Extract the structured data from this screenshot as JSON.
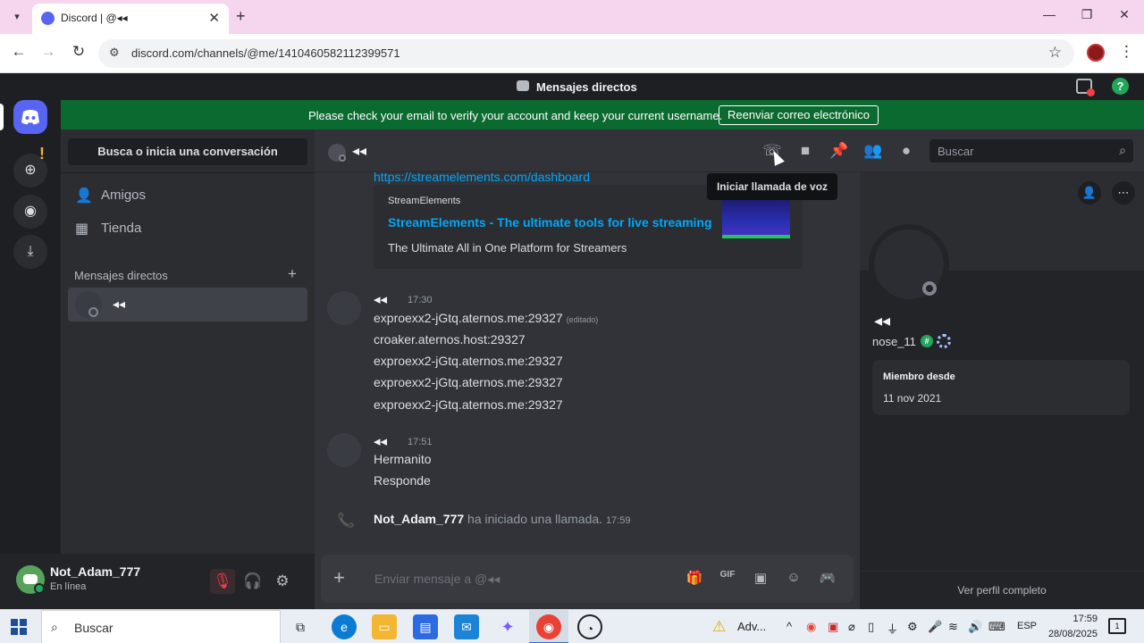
{
  "browser": {
    "tab_title": "Discord | @◂◂",
    "url": "discord.com/channels/@me/1410460582112399571"
  },
  "app_header": {
    "title": "Mensajes directos"
  },
  "banner": {
    "text": "Please check your email to verify your account and keep your current username.",
    "button": "Reenviar correo electrónico"
  },
  "sidebar": {
    "search_label": "Busca o inicia una conversación",
    "items": [
      {
        "label": "Amigos",
        "icon": "friends-icon"
      },
      {
        "label": "Tienda",
        "icon": "shop-icon"
      }
    ],
    "dm_header": "Mensajes directos",
    "dms": [
      {
        "name": "◂◂"
      }
    ]
  },
  "user_panel": {
    "name": "Not_Adam_777",
    "status": "En línea"
  },
  "chat_header": {
    "name": "◂◂",
    "search_placeholder": "Buscar",
    "tooltip": "Iniciar llamada de voz"
  },
  "chat": {
    "link": "https://streamelements.com/dashboard",
    "embed": {
      "provider": "StreamElements",
      "title": "StreamElements - The ultimate tools for live streaming",
      "description": "The Ultimate All in One Platform for Streamers"
    },
    "messages": [
      {
        "author": "◂◂",
        "time": "17:30",
        "lines": [
          "exproexx2-jGtq.aternos.me:29327",
          "croaker.aternos.host:29327",
          "exproexx2-jGtq.aternos.me:29327",
          "exproexx2-jGtq.aternos.me:29327",
          "exproexx2-jGtq.aternos.me:29327"
        ],
        "edited_label": "(editado)"
      },
      {
        "author": "◂◂",
        "time": "17:51",
        "lines": [
          "Hermanito",
          "Responde"
        ]
      }
    ],
    "call": {
      "user": "Not_Adam_777",
      "text": " ha iniciado una llamada. ",
      "time": "17:59"
    },
    "composer_placeholder": "Enviar mensaje a @◂◂"
  },
  "profile": {
    "display_name": "◂◂",
    "username": "nose_11",
    "member_since_label": "Miembro desde",
    "member_since": "11 nov 2021",
    "view_full": "Ver perfil completo"
  },
  "taskbar": {
    "search_label": "Buscar",
    "warning_label": "Adv...",
    "lang": "ESP",
    "time": "17:59",
    "date": "28/08/2025",
    "notification_count": "1"
  },
  "colors": {
    "accent": "#5865f2",
    "banner_green": "#0b6a2f",
    "online": "#23a55a",
    "link": "#00a8fc"
  }
}
